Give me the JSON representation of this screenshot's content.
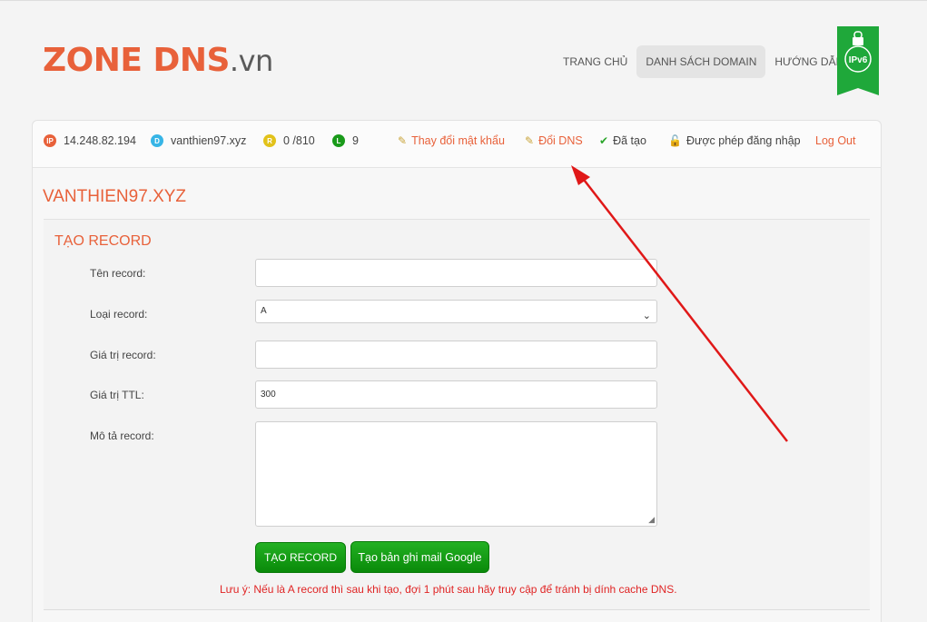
{
  "header": {
    "logo_main": "ZONE DNS",
    "logo_tld": ".vn",
    "nav": [
      {
        "label": "TRANG CHỦ"
      },
      {
        "label": "DANH SÁCH DOMAIN"
      },
      {
        "label": "HƯỚNG DẪN"
      }
    ],
    "ipv6_badge": "IPv6"
  },
  "infobar": {
    "ip": "14.248.82.194",
    "domain": "vanthien97.xyz",
    "records": "0 /810",
    "level": "9",
    "badges": {
      "ip": "IP",
      "domain": "D",
      "records": "R",
      "level": "L"
    },
    "links": {
      "change_password": "Thay đổi mật khẩu",
      "change_dns": "Đổi DNS",
      "created": "Đã tạo",
      "login_allowed": "Được phép đăng nhập",
      "logout": "Log Out"
    }
  },
  "domain_title": "VANTHIEN97.XYZ",
  "form": {
    "section_title": "TẠO RECORD",
    "labels": {
      "name": "Tên record:",
      "type": "Loại record:",
      "value": "Giá trị record:",
      "ttl": "Giá trị TTL:",
      "desc": "Mô tả record:"
    },
    "values": {
      "name": "",
      "type": "A",
      "value": "",
      "ttl": "300",
      "desc": ""
    },
    "buttons": {
      "create": "TẠO RECORD",
      "google_mail": "Tạo bản ghi mail Google"
    },
    "note": "Lưu ý: Nếu là A record thì sau khi tạo, đợi 1 phút sau hãy truy cập để tránh bị dính cache DNS."
  },
  "colors": {
    "accent": "#e8613a",
    "button_green": "#0a8a0a",
    "note_red": "#e02424",
    "arrow_red": "#e01818"
  }
}
